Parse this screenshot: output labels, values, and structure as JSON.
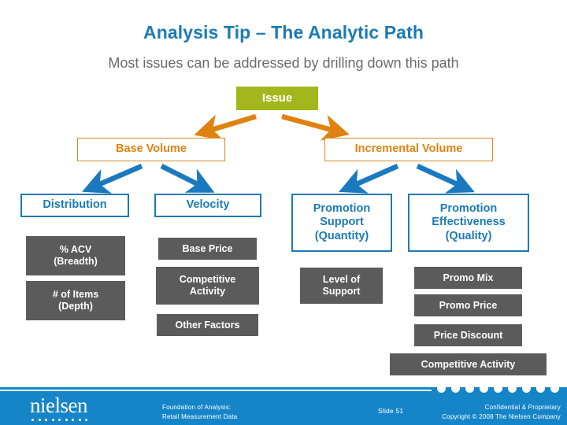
{
  "slide": {
    "title": "Analysis Tip – The Analytic Path",
    "subtitle": "Most issues can be addressed by drilling down this path"
  },
  "colors": {
    "title_blue": "#1a7bb5",
    "subtitle_gray": "#6b6b6b",
    "issue_olive": "#a3b71c",
    "orange_border": "#d78a22",
    "orange_text": "#e08214",
    "blue_border": "#1a7bb5",
    "blue_text": "#1a7bb5",
    "gray_fill": "#5b5b5b",
    "arrow_orange": "#e0820f",
    "arrow_blue": "#1b79bf",
    "footer_blue": "#1585c8"
  },
  "tree": {
    "root": {
      "label": "Issue"
    },
    "level1": [
      {
        "label": "Base Volume"
      },
      {
        "label": "Incremental Volume"
      }
    ],
    "level2": [
      {
        "label": "Distribution"
      },
      {
        "label": "Velocity"
      },
      {
        "label": "Promotion Support (Quantity)",
        "lines": [
          "Promotion",
          "Support",
          "(Quantity)"
        ]
      },
      {
        "label": "Promotion Effectiveness (Quality)",
        "lines": [
          "Promotion",
          "Effectiveness",
          "(Quality)"
        ]
      }
    ],
    "columns": [
      {
        "header": "Distribution",
        "items": [
          {
            "lines": [
              "% ACV",
              "(Breadth)"
            ]
          },
          {
            "lines": [
              "# of Items",
              "(Depth)"
            ]
          }
        ]
      },
      {
        "header": "Velocity",
        "items": [
          {
            "lines": [
              "Base Price"
            ]
          },
          {
            "lines": [
              "Competitive",
              "Activity"
            ]
          },
          {
            "lines": [
              "Other Factors"
            ]
          }
        ]
      },
      {
        "header": "Promotion Support (Quantity)",
        "items": [
          {
            "lines": [
              "Level of",
              "Support"
            ]
          }
        ]
      },
      {
        "header": "Promotion Effectiveness (Quality)",
        "items": [
          {
            "lines": [
              "Promo Mix"
            ]
          },
          {
            "lines": [
              "Promo Price"
            ]
          },
          {
            "lines": [
              "Price Discount"
            ]
          }
        ]
      }
    ],
    "footer_item": {
      "label": "Competitive Activity"
    }
  },
  "boxes": {
    "issue": "Issue",
    "base_volume": "Base Volume",
    "incremental_volume": "Incremental Volume",
    "distribution": "Distribution",
    "velocity": "Velocity",
    "promo_support_l1": "Promotion",
    "promo_support_l2": "Support",
    "promo_support_l3": "(Quantity)",
    "promo_eff_l1": "Promotion",
    "promo_eff_l2": "Effectiveness",
    "promo_eff_l3": "(Quality)",
    "acv_l1": "% ACV",
    "acv_l2": "(Breadth)",
    "items_l1": "# of Items",
    "items_l2": "(Depth)",
    "base_price": "Base Price",
    "comp_activity_l1": "Competitive",
    "comp_activity_l2": "Activity",
    "other_factors": "Other Factors",
    "level_support_l1": "Level of",
    "level_support_l2": "Support",
    "promo_mix": "Promo Mix",
    "promo_price": "Promo Price",
    "price_discount": "Price Discount",
    "competitive_activity_bottom": "Competitive Activity"
  },
  "footer": {
    "logo_text": "nielsen",
    "center_line1": "Foundation of Analysis:",
    "center_line2": "Retail Measurement Data",
    "slide_label": "Slide  51",
    "right_line1": "Confidential & Proprietary",
    "right_line2": "Copyright © 2008 The Nielsen Company"
  }
}
